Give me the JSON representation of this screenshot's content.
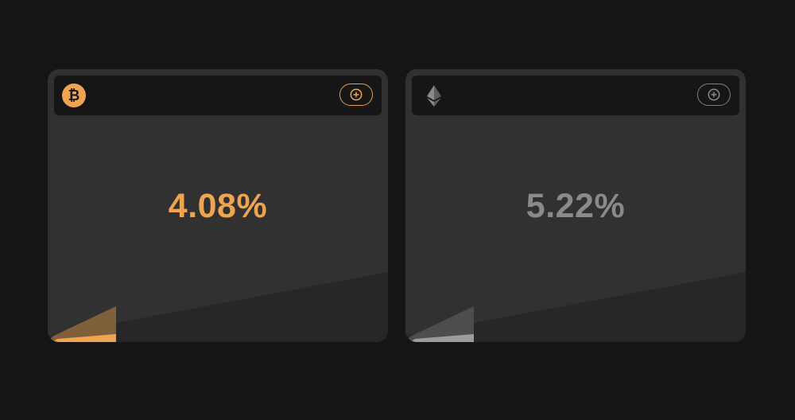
{
  "cards": [
    {
      "coin_icon": "bitcoin-icon",
      "rate": "4.08%",
      "add_icon": "plus-circle-icon",
      "accent": "#eea451",
      "progress": 0.2
    },
    {
      "coin_icon": "ethereum-icon",
      "rate": "5.22%",
      "add_icon": "plus-circle-icon",
      "accent": "#8a8a8a",
      "progress": 0.2
    }
  ],
  "colors": {
    "page_background": "#151517",
    "card_background": "#313131",
    "header_background": "#161617",
    "lower_band": "#272727"
  }
}
